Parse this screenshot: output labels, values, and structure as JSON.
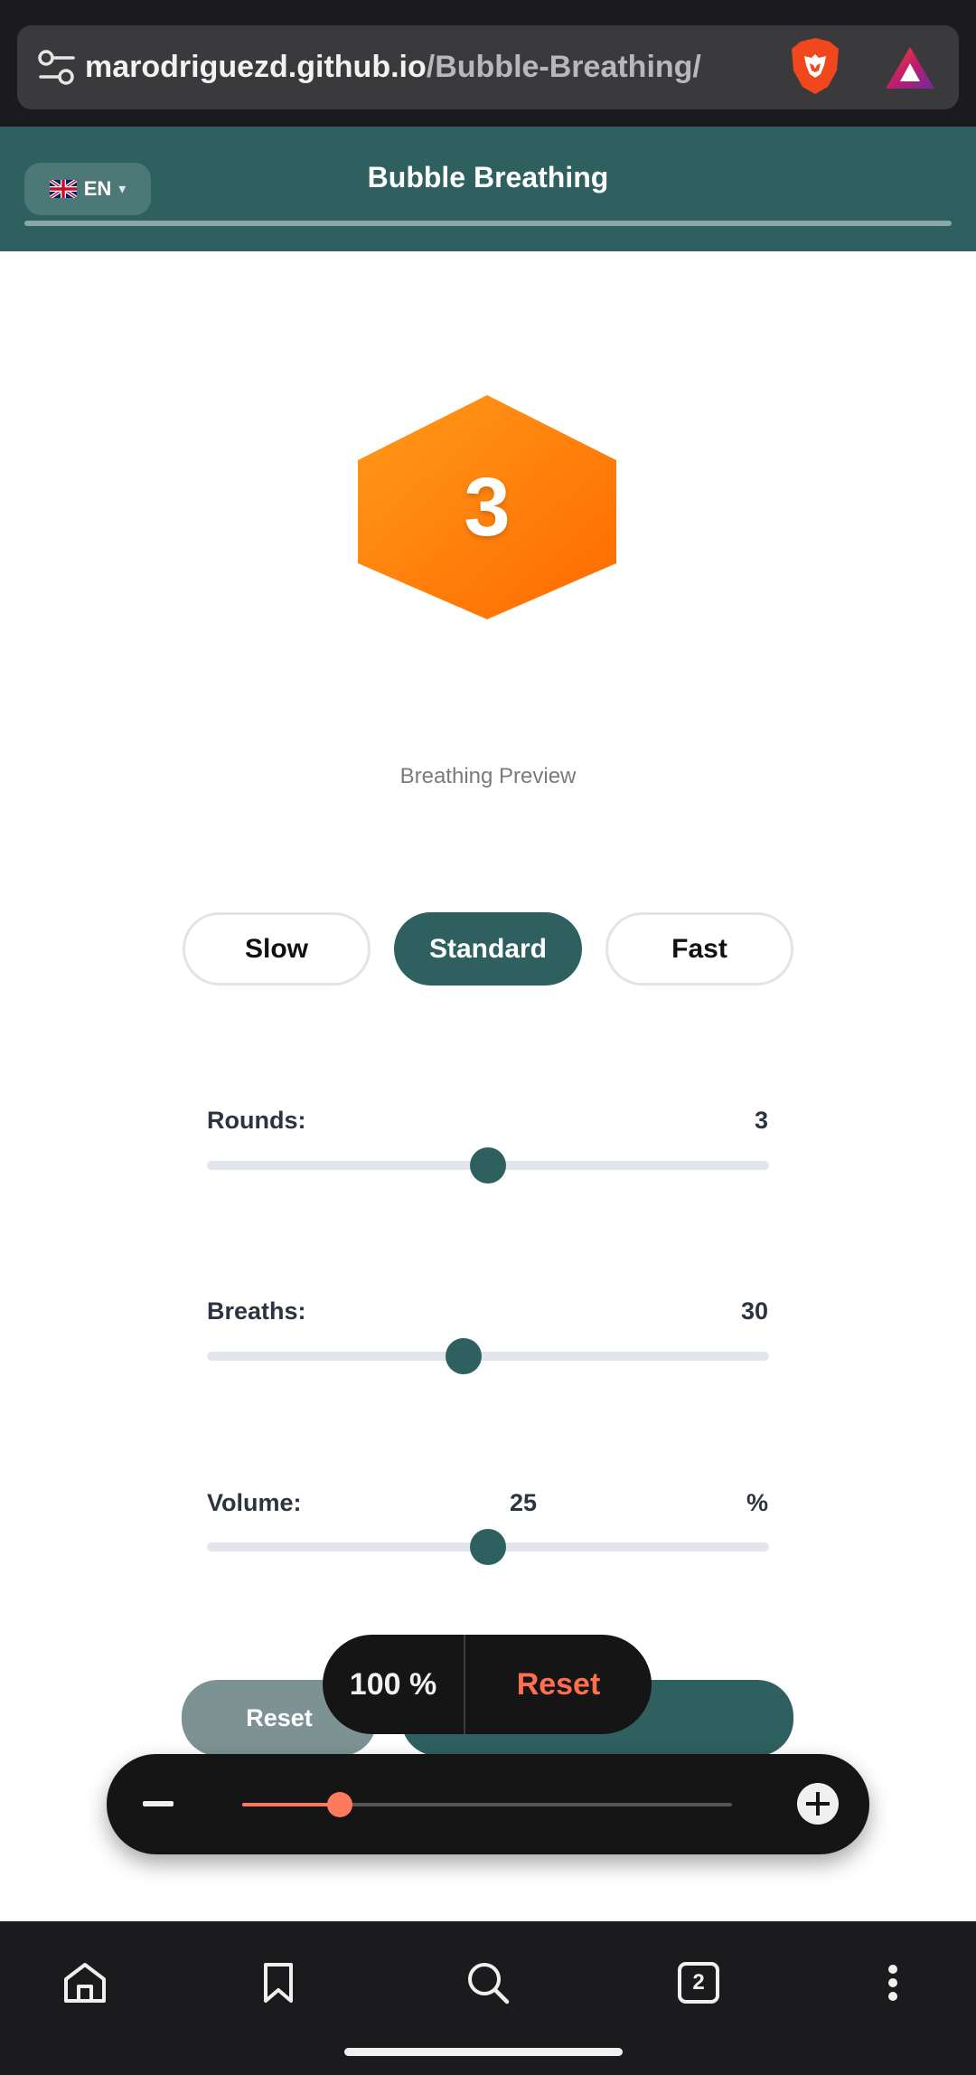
{
  "browser": {
    "url_host": "marodriguezd.github.io",
    "url_path": "/Bubble-Breathing/",
    "tabs_count": "2"
  },
  "header": {
    "language": "EN",
    "language_caret": "▾",
    "title": "Bubble Breathing"
  },
  "preview": {
    "count": "3",
    "label": "Breathing Preview"
  },
  "pace": {
    "options": [
      "Slow",
      "Standard",
      "Fast"
    ],
    "selected": "Standard"
  },
  "settings": {
    "rounds": {
      "label": "Rounds:",
      "value": "3",
      "fraction": 0.5
    },
    "breaths": {
      "label": "Breaths:",
      "value": "30",
      "fraction": 0.456
    },
    "volume": {
      "label": "Volume:",
      "value": "25",
      "unit": "%",
      "fraction": 0.5
    }
  },
  "actions": {
    "reset_label": "Reset"
  },
  "zoom": {
    "level": "100 %",
    "reset_label": "Reset",
    "fraction": 0.2
  },
  "colors": {
    "primary": "#2e6060",
    "hex_start": "#ff9a1a",
    "hex_end": "#ff6a00",
    "accent": "#ff7a5c"
  }
}
